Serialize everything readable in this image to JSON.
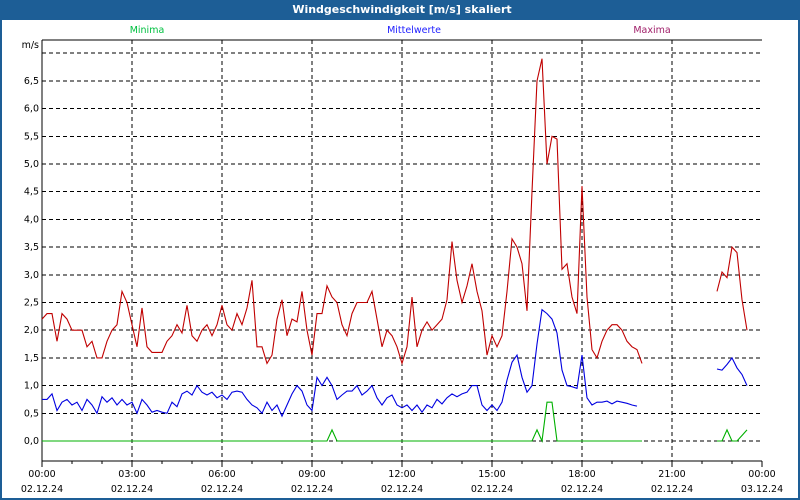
{
  "window": {
    "title": "Windgeschwindigkeit [m/s] skaliert"
  },
  "chart_data": {
    "type": "line",
    "title": "Windgeschwindigkeit [m/s] skaliert",
    "ylabel": "m/s",
    "xlabel": "",
    "ylim": [
      -0.36,
      7.0
    ],
    "yticks": [
      0,
      0.5,
      1,
      1.5,
      2,
      2.5,
      3,
      3.5,
      4,
      4.5,
      5,
      5.5,
      6,
      6.5,
      7
    ],
    "ytick_labels": [
      "0,0",
      "0,5",
      "1,0",
      "1,5",
      "2,0",
      "2,5",
      "3,0",
      "3,5",
      "4,0",
      "4,5",
      "5,0",
      "5,5",
      "6,0",
      "6,5",
      ""
    ],
    "xlim_hours": [
      0,
      24
    ],
    "xticks": [
      {
        "time": "00:00",
        "date": "02.12.24"
      },
      {
        "time": "03:00",
        "date": "02.12.24"
      },
      {
        "time": "06:00",
        "date": "02.12.24"
      },
      {
        "time": "09:00",
        "date": "02.12.24"
      },
      {
        "time": "12:00",
        "date": "02.12.24"
      },
      {
        "time": "15:00",
        "date": "02.12.24"
      },
      {
        "time": "18:00",
        "date": "02.12.24"
      },
      {
        "time": "21:00",
        "date": "02.12.24"
      },
      {
        "time": "00:00",
        "date": "03.12.24"
      }
    ],
    "grid": true,
    "legend_placement": "top",
    "sample_interval_minutes": 10,
    "start_time": "00:00",
    "series": [
      {
        "name": "Minima",
        "color": "#00b000",
        "label_color": "#00c040",
        "values": [
          0,
          0,
          0,
          0,
          0,
          0,
          0,
          0,
          0,
          0,
          0,
          0,
          0,
          0,
          0,
          0,
          0,
          0,
          0,
          0,
          0,
          0,
          0,
          0,
          0,
          0,
          0,
          0,
          0,
          0,
          0,
          0,
          0,
          0,
          0,
          0,
          0,
          0,
          0,
          0,
          0,
          0,
          0,
          0,
          0,
          0,
          0,
          0,
          0,
          0,
          0,
          0,
          0,
          0,
          0,
          0,
          0,
          0,
          0.2,
          0,
          0,
          0,
          0,
          0,
          0,
          0,
          0,
          0,
          0,
          0,
          0,
          0,
          0,
          0,
          0,
          0,
          0,
          0,
          0,
          0,
          0,
          0,
          0,
          0,
          0,
          0,
          0,
          0,
          0,
          0,
          0,
          0,
          0,
          0,
          0,
          0,
          0,
          0,
          0,
          0.2,
          0,
          0.7,
          0.7,
          0,
          0,
          0,
          0,
          0,
          0,
          0,
          0,
          0,
          0,
          0,
          0,
          0,
          0,
          0,
          0,
          0,
          0,
          null,
          null,
          null,
          null,
          null,
          null,
          null,
          null,
          null,
          null,
          null,
          null,
          null,
          null,
          0,
          0,
          0.2,
          0,
          0,
          0.1,
          0.2
        ]
      },
      {
        "name": "Mittelwerte",
        "color": "#0000e0",
        "label_color": "#2020ff",
        "values": [
          0.75,
          0.75,
          0.85,
          0.55,
          0.7,
          0.75,
          0.65,
          0.7,
          0.55,
          0.75,
          0.65,
          0.5,
          0.8,
          0.7,
          0.78,
          0.65,
          0.75,
          0.65,
          0.7,
          0.5,
          0.75,
          0.65,
          0.52,
          0.55,
          0.52,
          0.5,
          0.7,
          0.62,
          0.85,
          0.9,
          0.83,
          1.0,
          0.88,
          0.83,
          0.88,
          0.78,
          0.83,
          0.75,
          0.88,
          0.9,
          0.88,
          0.75,
          0.65,
          0.6,
          0.5,
          0.7,
          0.55,
          0.65,
          0.45,
          0.65,
          0.85,
          1.0,
          0.9,
          0.65,
          0.55,
          1.15,
          1.0,
          1.15,
          1.0,
          0.75,
          0.83,
          0.9,
          0.9,
          1.0,
          0.83,
          0.9,
          1.0,
          0.78,
          0.65,
          0.78,
          0.83,
          0.65,
          0.6,
          0.65,
          0.55,
          0.65,
          0.52,
          0.65,
          0.6,
          0.75,
          0.67,
          0.78,
          0.85,
          0.8,
          0.85,
          0.88,
          1.0,
          1.0,
          0.65,
          0.55,
          0.65,
          0.55,
          0.7,
          1.1,
          1.42,
          1.55,
          1.15,
          0.88,
          1.0,
          1.75,
          2.37,
          2.3,
          2.2,
          1.95,
          1.28,
          1.0,
          0.98,
          0.95,
          1.55,
          0.78,
          0.65,
          0.7,
          0.7,
          0.72,
          0.67,
          0.72,
          0.7,
          0.68,
          0.65,
          0.63,
          null,
          null,
          null,
          null,
          null,
          null,
          null,
          null,
          null,
          null,
          null,
          null,
          null,
          null,
          null,
          1.3,
          1.28,
          1.38,
          1.5,
          1.32,
          1.2,
          1.0
        ]
      },
      {
        "name": "Maxima",
        "color": "#c00000",
        "label_color": "#a0206a",
        "values": [
          2.2,
          2.3,
          2.3,
          1.8,
          2.3,
          2.2,
          2.0,
          2.0,
          2.0,
          1.7,
          1.8,
          1.5,
          1.5,
          1.8,
          2.0,
          2.1,
          2.7,
          2.5,
          2.1,
          1.7,
          2.4,
          1.7,
          1.6,
          1.6,
          1.6,
          1.8,
          1.9,
          2.1,
          1.95,
          2.45,
          1.9,
          1.8,
          2.0,
          2.1,
          1.9,
          2.1,
          2.45,
          2.1,
          2.0,
          2.3,
          2.1,
          2.4,
          2.9,
          1.7,
          1.7,
          1.4,
          1.55,
          2.2,
          2.55,
          1.9,
          2.2,
          2.15,
          2.7,
          2.0,
          1.55,
          2.3,
          2.3,
          2.8,
          2.6,
          2.5,
          2.1,
          1.9,
          2.3,
          2.5,
          2.5,
          2.5,
          2.7,
          2.2,
          1.7,
          2.0,
          1.9,
          1.7,
          1.4,
          1.7,
          2.6,
          1.7,
          2.0,
          2.15,
          2.0,
          2.1,
          2.2,
          2.55,
          3.6,
          2.9,
          2.5,
          2.8,
          3.2,
          2.7,
          2.35,
          1.55,
          1.9,
          1.7,
          1.9,
          2.7,
          3.65,
          3.5,
          3.2,
          2.35,
          4.5,
          6.5,
          6.9,
          5.0,
          5.5,
          5.45,
          3.1,
          3.2,
          2.6,
          2.3,
          4.6,
          2.6,
          1.65,
          1.5,
          1.8,
          2.0,
          2.1,
          2.1,
          2.0,
          1.8,
          1.7,
          1.65,
          1.4,
          null,
          null,
          null,
          null,
          null,
          null,
          null,
          null,
          null,
          null,
          null,
          null,
          null,
          null,
          2.7,
          3.05,
          2.95,
          3.5,
          3.4,
          2.55,
          2.0
        ]
      }
    ]
  }
}
